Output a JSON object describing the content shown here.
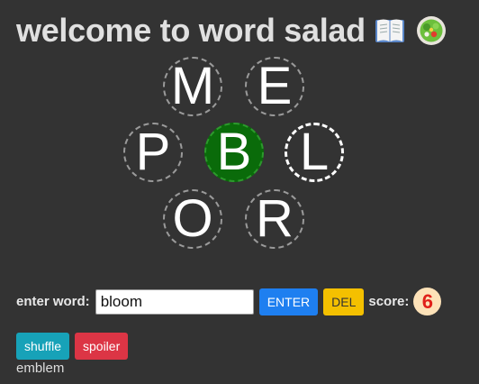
{
  "header": {
    "title": "welcome to word salad",
    "icon_book": "open-book-icon",
    "icon_salad": "salad-icon"
  },
  "letters": {
    "top_left": "M",
    "top_right": "E",
    "middle_left": "P",
    "center": "B",
    "middle_right": "L",
    "bottom_left": "O",
    "bottom_right": "R"
  },
  "input": {
    "label": "enter word:",
    "value": "bloom"
  },
  "buttons": {
    "enter": "ENTER",
    "del": "DEL",
    "shuffle": "shuffle",
    "spoiler": "spoiler"
  },
  "score": {
    "label": "score:",
    "value": "6"
  },
  "found_words": [
    "emblem"
  ],
  "colors": {
    "background": "#333333",
    "center_tile": "#0a6b0a",
    "enter": "#1e7ff0",
    "del": "#f4c000",
    "shuffle": "#17a2b8",
    "spoiler": "#dc3545",
    "score_badge": "#fde2b8",
    "score_text": "#e0201a"
  }
}
